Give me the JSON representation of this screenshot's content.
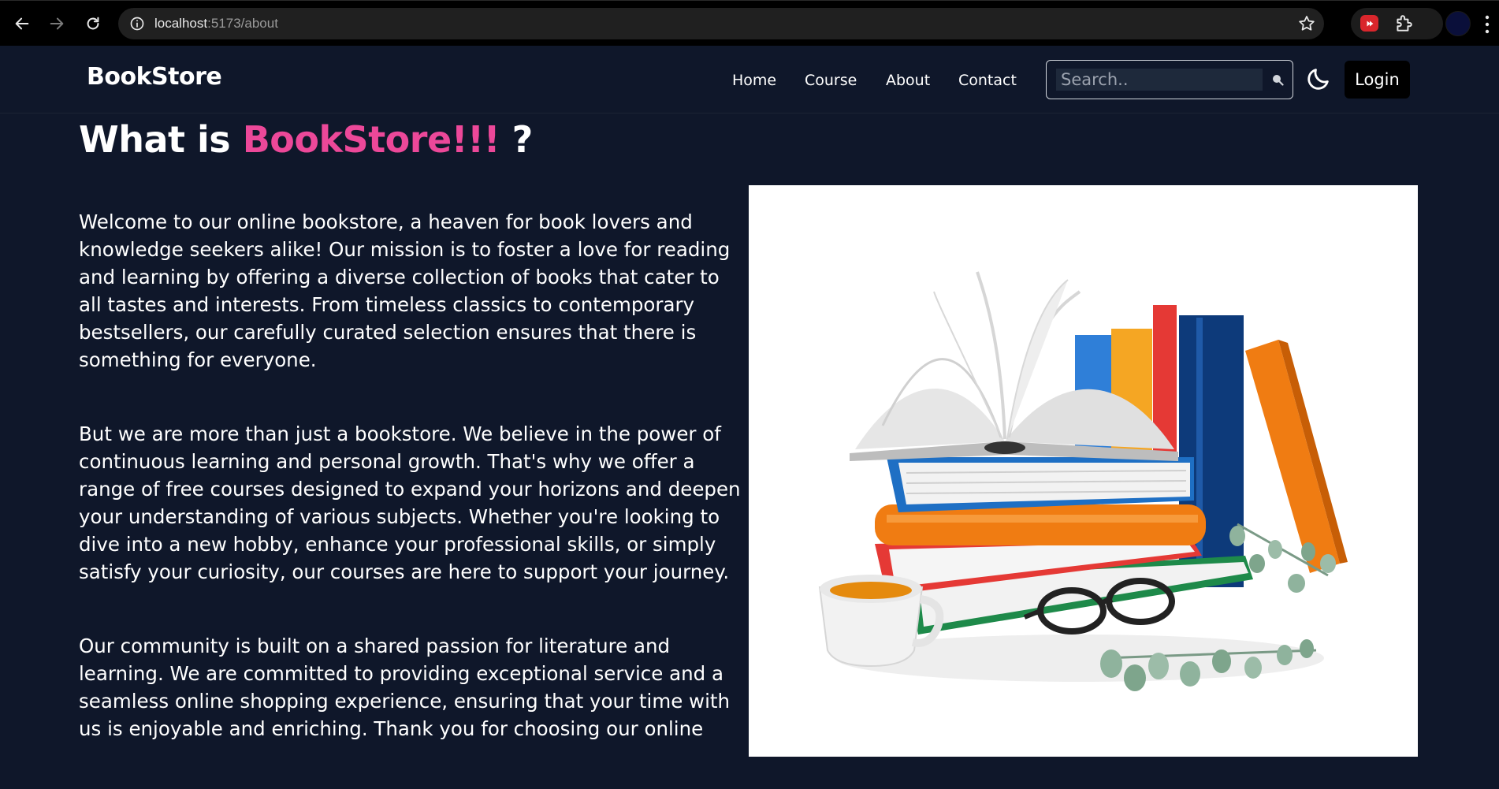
{
  "browser": {
    "url_host": "localhost",
    "url_path": ":5173/about",
    "icons": [
      "back-arrow-icon",
      "forward-arrow-icon",
      "reload-icon",
      "site-info-icon",
      "bookmark-star-icon",
      "youtube-extension-icon",
      "extensions-puzzle-icon",
      "profile-avatar",
      "more-menu-icon"
    ]
  },
  "navbar": {
    "logo": "BookStore",
    "links": [
      "Home",
      "Course",
      "About",
      "Contact"
    ],
    "search_placeholder": "Search..",
    "login_label": "Login"
  },
  "main": {
    "title_prefix": "What is ",
    "title_brand": "BookStore!!!",
    "title_suffix": " ?",
    "paragraphs": [
      "Welcome to our online bookstore, a heaven for book lovers and knowledge seekers alike! Our mission is to foster a love for reading and learning by offering a diverse collection of books that cater to all tastes and interests. From timeless classics to contemporary bestsellers, our carefully curated selection ensures that there is something for everyone.",
      "But we are more than just a bookstore. We believe in the power of continuous learning and personal growth. That's why we offer a range of free courses designed to expand your horizons and deepen your understanding of various subjects. Whether you're looking to dive into a new hobby, enhance your professional skills, or simply satisfy your curiosity, our courses are here to support your journey.",
      "Our community is built on a shared passion for literature and learning. We are committed to providing exceptional service and a seamless online shopping experience, ensuring that your time with us is enjoyable and enriching. Thank you for choosing our online"
    ]
  },
  "colors": {
    "background": "#0f172a",
    "brand_pink": "#ec4899",
    "login_bg": "#000000"
  }
}
